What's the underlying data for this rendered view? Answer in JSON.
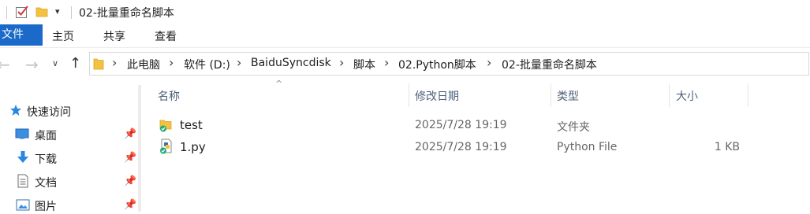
{
  "window": {
    "title": "02-批量重命名脚本"
  },
  "ribbon": {
    "tabs": [
      "文件",
      "主页",
      "共享",
      "查看"
    ]
  },
  "address": {
    "crumbs": [
      "此电脑",
      "软件 (D:)",
      "BaiduSyncdisk",
      "脚本",
      "02.Python脚本",
      "02-批量重命名脚本"
    ]
  },
  "nav_pane": {
    "quick_access": "快速访问",
    "items": [
      {
        "label": "桌面",
        "icon": "desktop-icon"
      },
      {
        "label": "下载",
        "icon": "download-icon"
      },
      {
        "label": "文档",
        "icon": "document-icon"
      },
      {
        "label": "图片",
        "icon": "pictures-icon"
      }
    ]
  },
  "file_list": {
    "columns": {
      "name": "名称",
      "date": "修改日期",
      "type": "类型",
      "size": "大小"
    },
    "rows": [
      {
        "name": "test",
        "date": "2025/7/28 19:19",
        "type": "文件夹",
        "size": "",
        "icon": "folder-synced-icon"
      },
      {
        "name": "1.py",
        "date": "2025/7/28 19:19",
        "type": "Python File",
        "size": "1 KB",
        "icon": "python-file-synced-icon"
      }
    ]
  },
  "colors": {
    "accent": "#1b6ac9",
    "folder": "#f4c242",
    "sync_badge": "#1fa97a"
  }
}
